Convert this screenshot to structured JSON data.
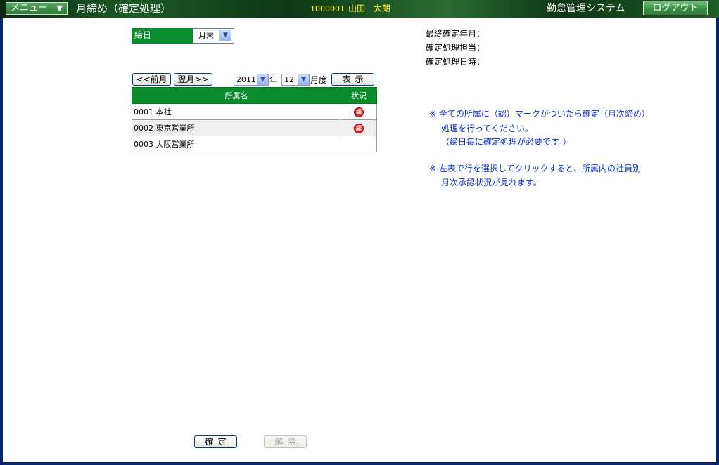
{
  "header": {
    "menu_label": "メニュー",
    "screen_title": "月締め（確定処理）",
    "user_id": "1000001",
    "user_name": "山田 太朗",
    "system_name": "勤怠管理システム",
    "logout_label": "ログアウト"
  },
  "closing": {
    "label": "締日",
    "selected": "月末"
  },
  "info": {
    "last_confirmed_label": "最終確定年月：",
    "confirm_person_label": "確定処理担当：",
    "confirm_datetime_label": "確定処理日時："
  },
  "nav": {
    "prev_label": "<<前月",
    "next_label": "翌月>>",
    "year": "2011",
    "year_unit": "年",
    "month": "12",
    "month_unit": "月度",
    "show_label": "表示"
  },
  "table": {
    "headers": {
      "name": "所属名",
      "status": "状況"
    },
    "rows": [
      {
        "name": "0001 本社",
        "approved": true
      },
      {
        "name": "0002 東京営業所",
        "approved": true
      },
      {
        "name": "0003 大阪営業所",
        "approved": false
      }
    ],
    "stamp_text": "認"
  },
  "notes": {
    "note1_line1": "※ 全ての所属に（認）マークがついたら確定（月次締め）",
    "note1_line2": "処理を行ってください。",
    "note1_line3": "（締日毎に確定処理が必要です。）",
    "note2_line1": "※ 左表で行を選択してクリックすると、所属内の社員別",
    "note2_line2": "月次承認状況が見れます。"
  },
  "footer": {
    "confirm_label": "確定",
    "release_label": "解除"
  },
  "colors": {
    "header_green": "#1d5a25",
    "table_header_green": "#0a8c2e",
    "stamp_red": "#e62020",
    "note_blue": "#1030c8",
    "user_yellow": "#ffff33"
  }
}
